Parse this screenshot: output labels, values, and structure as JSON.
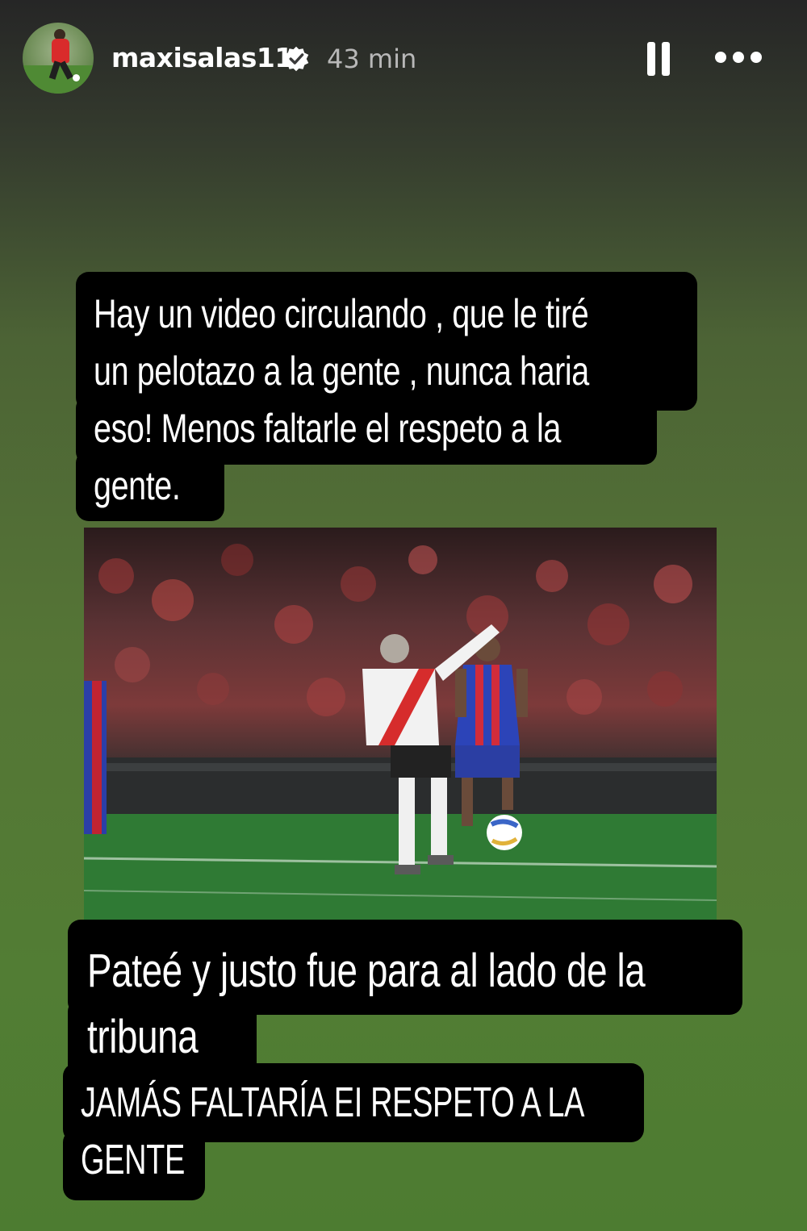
{
  "header": {
    "username": "maxisalas11",
    "time": "43 min",
    "verified": true,
    "icons": [
      "verified-badge-icon",
      "pause-icon",
      "more-icon"
    ]
  },
  "story": {
    "text1": {
      "lines": [
        "Hay un video circulando  , que le tiré",
        "un pelotazo a la gente , nunca haria",
        "eso! Menos faltarle el respeto a la",
        "gente."
      ]
    },
    "text2": {
      "lines": [
        "Pateé y justo fue para al lado de la",
        "tribuna"
      ]
    },
    "text3": {
      "lines": [
        "JAMÁS FALTARÍA EI RESPETO A LA",
        "GENTE"
      ]
    }
  }
}
